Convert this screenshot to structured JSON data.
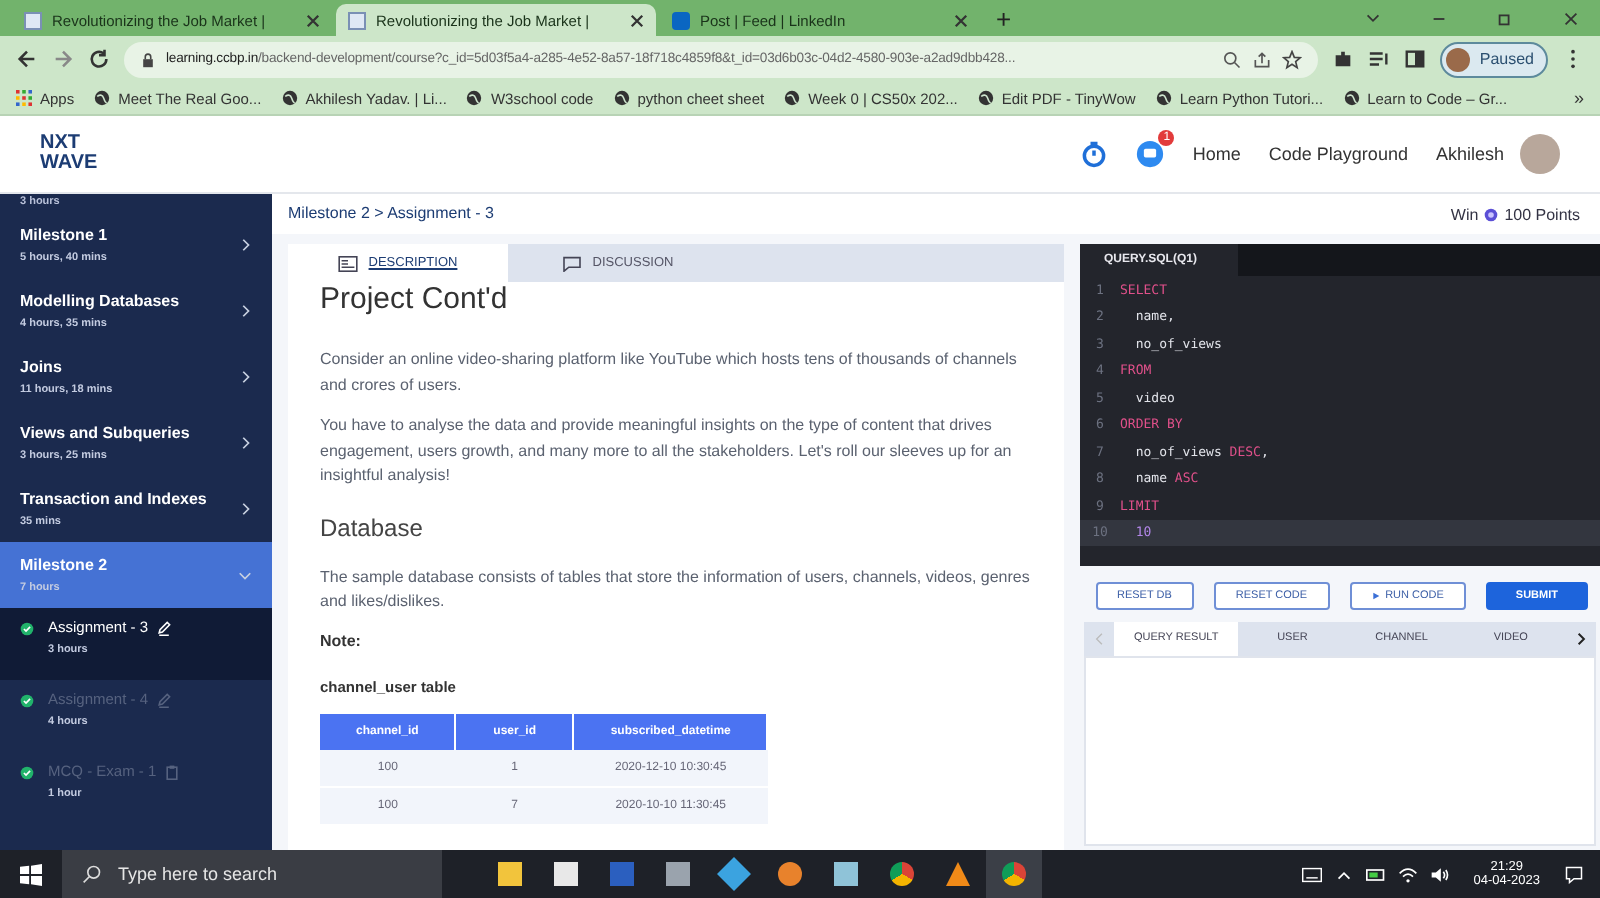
{
  "browser": {
    "tabs": [
      {
        "title": "Revolutionizing the Job Market |",
        "selected": false,
        "kind": "page"
      },
      {
        "title": "Revolutionizing the Job Market |",
        "selected": true,
        "kind": "page"
      },
      {
        "title": "Post | Feed | LinkedIn",
        "selected": false,
        "kind": "social"
      }
    ],
    "new_tab": "+",
    "url_host": "learning.ccbp.in",
    "url_path": "/backend-development/course?c_id=5d03f5a4-a285-4e52-8a57-18f718c4859f8&t_id=03d6b03c-04d2-4580-903e-a2ad9dbb428...",
    "profile": "Paused",
    "bookmarks": [
      "Apps",
      "Meet The Real Goo...",
      "Akhilesh Yadav. | Li...",
      "W3school code",
      "python cheet sheet",
      "Week 0 | CS50x 202...",
      "Edit PDF - TinyWow",
      "Learn Python Tutori...",
      "Learn to Code – Gr..."
    ],
    "more": "»"
  },
  "header": {
    "logo_top": "NXT",
    "logo_bottom": "WAVE",
    "notifications": "1",
    "nav": [
      "Home",
      "Code Playground"
    ],
    "user": "Akhilesh"
  },
  "sidebar": {
    "cut_duration": "3 hours",
    "items": [
      {
        "title": "Milestone 1",
        "duration": "5 hours, 40 mins",
        "selected": false,
        "expanded": false
      },
      {
        "title": "Modelling Databases",
        "duration": "4 hours, 35 mins",
        "selected": false,
        "expanded": false
      },
      {
        "title": "Joins",
        "duration": "11 hours, 18 mins",
        "selected": false,
        "expanded": false
      },
      {
        "title": "Views and Subqueries",
        "duration": "3 hours, 25 mins",
        "selected": false,
        "expanded": false
      },
      {
        "title": "Transaction and Indexes",
        "duration": "35 mins",
        "selected": false,
        "expanded": false
      },
      {
        "title": "Milestone 2",
        "duration": "7 hours",
        "selected": true,
        "expanded": true,
        "children": [
          {
            "title": "Assignment - 3",
            "duration": "3 hours",
            "kind": "assignment",
            "selected": true,
            "done": true
          },
          {
            "title": "Assignment - 4",
            "duration": "4 hours",
            "kind": "assignment",
            "selected": false,
            "done": true
          },
          {
            "title": "MCQ - Exam - 1",
            "duration": "1 hour",
            "kind": "exam",
            "selected": false,
            "done": true
          }
        ]
      }
    ]
  },
  "breadcrumb": "Milestone 2 > Assignment - 3",
  "content_tabs": [
    {
      "label": "DESCRIPTION",
      "selected": true
    },
    {
      "label": "DISCUSSION",
      "selected": false
    }
  ],
  "article": {
    "title": "Project Cont'd",
    "paragraphs": [
      "Consider an online video-sharing platform like YouTube which hosts tens of thousands of channels and crores of users.",
      "You have to analyse the data and provide meaningful insights on the type of content that drives engagement, users growth, and many more to all the stakeholders. Let's roll our sleeves up for an insightful analysis!"
    ],
    "heading": "Database",
    "paragraph2": "The sample database consists of tables that store the information of users, channels, videos, genres and likes/dislikes.",
    "note": "Note:",
    "table_title": "channel_user table",
    "table": {
      "columns": [
        "channel_id",
        "user_id",
        "subscribed_datetime"
      ],
      "rows": [
        [
          "100",
          "1",
          "2020-12-10 10:30:45"
        ],
        [
          "100",
          "7",
          "2020-10-10 11:30:45"
        ]
      ]
    }
  },
  "points": {
    "label": "Win",
    "value": "100 Points"
  },
  "editor": {
    "file": "QUERY.SQL(Q1)",
    "lines": [
      {
        "no": "1",
        "active": false,
        "tokens": [
          {
            "text": "SELECT",
            "kind": "keyword"
          }
        ]
      },
      {
        "no": "2",
        "active": false,
        "tokens": [
          {
            "text": "  name,",
            "kind": "plain"
          }
        ]
      },
      {
        "no": "3",
        "active": false,
        "tokens": [
          {
            "text": "  no_of_views",
            "kind": "plain"
          }
        ]
      },
      {
        "no": "4",
        "active": false,
        "tokens": [
          {
            "text": "FROM",
            "kind": "keyword"
          }
        ]
      },
      {
        "no": "5",
        "active": false,
        "tokens": [
          {
            "text": "  video",
            "kind": "plain"
          }
        ]
      },
      {
        "no": "6",
        "active": false,
        "tokens": [
          {
            "text": "ORDER BY",
            "kind": "keyword"
          }
        ]
      },
      {
        "no": "7",
        "active": false,
        "tokens": [
          {
            "text": "  no_of_views ",
            "kind": "plain"
          },
          {
            "text": "DESC",
            "kind": "keyword"
          },
          {
            "text": ",",
            "kind": "plain"
          }
        ]
      },
      {
        "no": "8",
        "active": false,
        "tokens": [
          {
            "text": "  name ",
            "kind": "plain"
          },
          {
            "text": "ASC",
            "kind": "keyword"
          }
        ]
      },
      {
        "no": "9",
        "active": false,
        "tokens": [
          {
            "text": "LIMIT",
            "kind": "keyword"
          }
        ]
      },
      {
        "no": "10",
        "active": true,
        "tokens": [
          {
            "text": "  10",
            "kind": "number"
          }
        ]
      }
    ]
  },
  "actions": [
    {
      "label": "RESET DB",
      "kind": "outline"
    },
    {
      "label": "RESET CODE",
      "kind": "outline"
    },
    {
      "label": "RUN CODE",
      "kind": "run"
    },
    {
      "label": "SUBMIT",
      "kind": "primary"
    }
  ],
  "result_tabs": [
    {
      "label": "QUERY RESULT",
      "selected": true
    },
    {
      "label": "USER",
      "selected": false
    },
    {
      "label": "CHANNEL",
      "selected": false
    },
    {
      "label": "VIDEO",
      "selected": false
    }
  ],
  "taskbar": {
    "search_placeholder": "Type here to search",
    "time": "21:29",
    "date": "04-04-2023"
  }
}
